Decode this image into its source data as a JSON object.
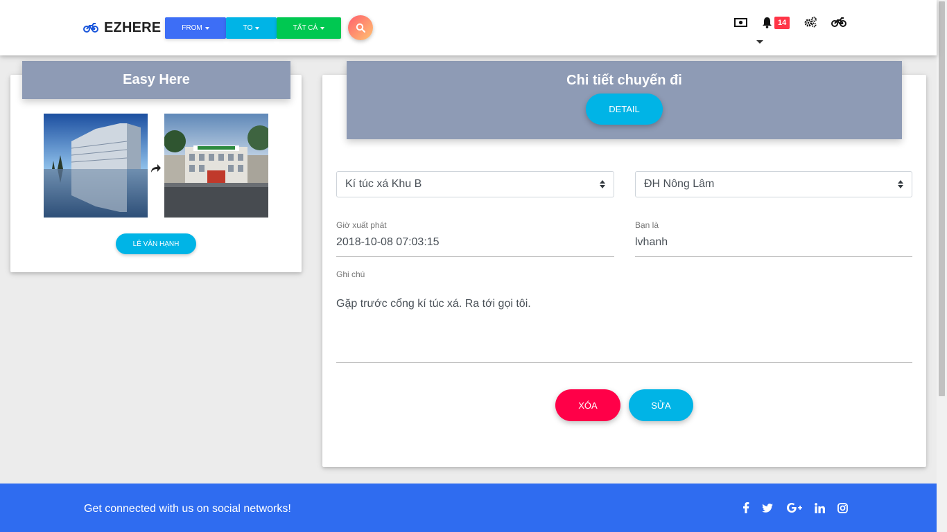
{
  "brand": {
    "name": "EZHERE",
    "icon": "motorcycle-icon"
  },
  "nav": {
    "from_label": "FROM",
    "to_label": "TO",
    "all_label": "TẤT CẢ",
    "notification_count": "14",
    "colors": {
      "from": "#3d6ef6",
      "to": "#00b4e6",
      "all": "#00c851"
    }
  },
  "left_card": {
    "title": "Easy Here",
    "person_button": "LÊ VĂN HẠNH"
  },
  "trip": {
    "title": "Chi tiết chuyến đi",
    "detail_button": "DETAIL",
    "from_select": "Kí túc xá Khu B",
    "to_select": "ĐH Nông Lâm",
    "departure_label": "Giờ xuất phát",
    "departure_value": "2018-10-08 07:03:15",
    "user_label": "Bạn là",
    "user_value": "lvhanh",
    "note_label": "Ghi chú",
    "note_value": "Gặp trước cổng kí túc xá. Ra tới gọi tôi.",
    "delete_button": "XÓA",
    "edit_button": "SỬA",
    "colors": {
      "delete": "#ff0048",
      "edit": "#00b4e6"
    }
  },
  "footer": {
    "text": "Get connected with us on social networks!",
    "icons": [
      "facebook-icon",
      "twitter-icon",
      "google-plus-icon",
      "linkedin-icon",
      "instagram-icon"
    ]
  }
}
